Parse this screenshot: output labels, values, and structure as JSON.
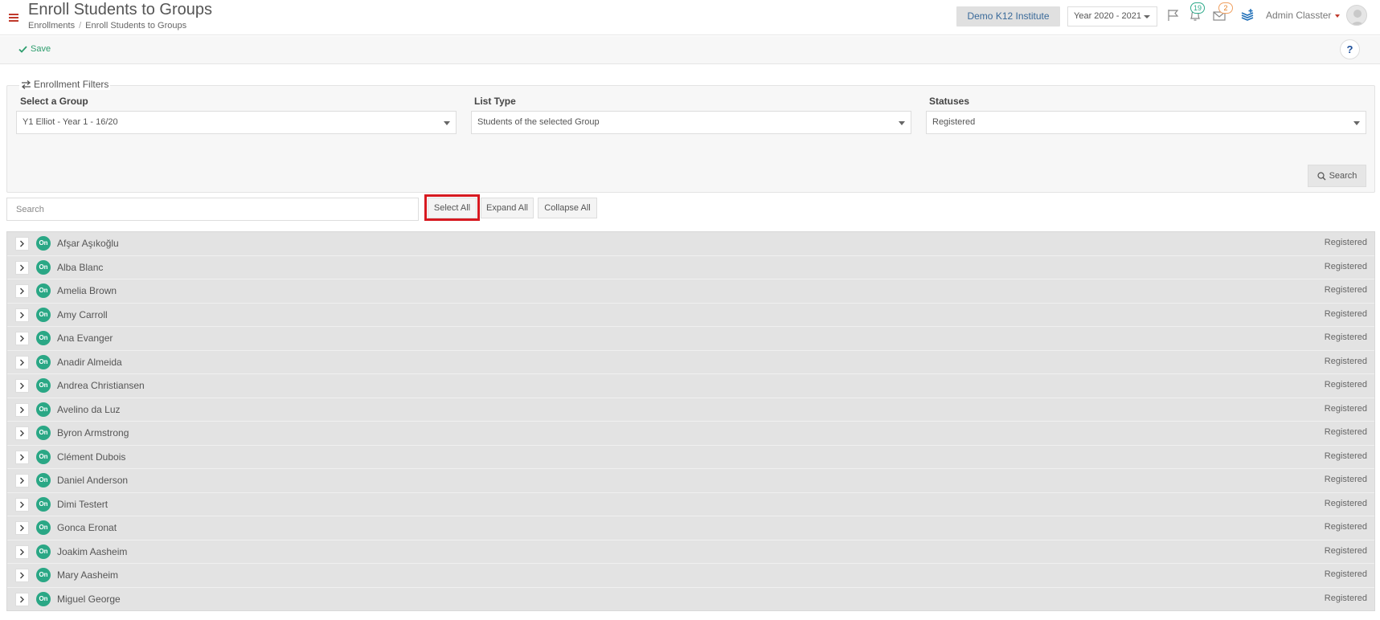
{
  "header": {
    "title": "Enroll Students to Groups",
    "breadcrumb": [
      "Enrollments",
      "Enroll Students to Groups"
    ],
    "institute": "Demo K12 Institute",
    "year": "Year 2020 - 2021",
    "notifications_count": "19",
    "messages_count": "2",
    "user_name": "Admin Classter"
  },
  "toolbar": {
    "save_label": "Save",
    "help_label": "?"
  },
  "filters": {
    "legend": "Enrollment Filters",
    "group_label": "Select a Group",
    "group_value": "Y1 Elliot - Year 1 - 16/20",
    "list_type_label": "List Type",
    "list_type_value": "Students of the selected Group",
    "statuses_label": "Statuses",
    "statuses_value": "Registered",
    "search_button": "Search"
  },
  "list_controls": {
    "search_placeholder": "Search",
    "select_all": "Select All",
    "expand_all": "Expand All",
    "collapse_all": "Collapse All"
  },
  "students": [
    {
      "name": "Afşar Aşıkoğlu",
      "status": "Registered",
      "badge": "On"
    },
    {
      "name": "Alba Blanc",
      "status": "Registered",
      "badge": "On"
    },
    {
      "name": "Amelia Brown",
      "status": "Registered",
      "badge": "On"
    },
    {
      "name": "Amy Carroll",
      "status": "Registered",
      "badge": "On"
    },
    {
      "name": "Ana Evanger",
      "status": "Registered",
      "badge": "On"
    },
    {
      "name": "Anadir Almeida",
      "status": "Registered",
      "badge": "On"
    },
    {
      "name": "Andrea Christiansen",
      "status": "Registered",
      "badge": "On"
    },
    {
      "name": "Avelino da Luz",
      "status": "Registered",
      "badge": "On"
    },
    {
      "name": "Byron Armstrong",
      "status": "Registered",
      "badge": "On"
    },
    {
      "name": "Clément Dubois",
      "status": "Registered",
      "badge": "On"
    },
    {
      "name": "Daniel Anderson",
      "status": "Registered",
      "badge": "On"
    },
    {
      "name": "Dimi Testert",
      "status": "Registered",
      "badge": "On"
    },
    {
      "name": "Gonca Eronat",
      "status": "Registered",
      "badge": "On"
    },
    {
      "name": "Joakim Aasheim",
      "status": "Registered",
      "badge": "On"
    },
    {
      "name": "Mary Aasheim",
      "status": "Registered",
      "badge": "On"
    },
    {
      "name": "Miguel George",
      "status": "Registered",
      "badge": "On"
    }
  ],
  "colors": {
    "accent_red": "#c0392b",
    "on_badge": "#2aa785",
    "save_green": "#2e9e6e",
    "highlight": "#d71920"
  }
}
